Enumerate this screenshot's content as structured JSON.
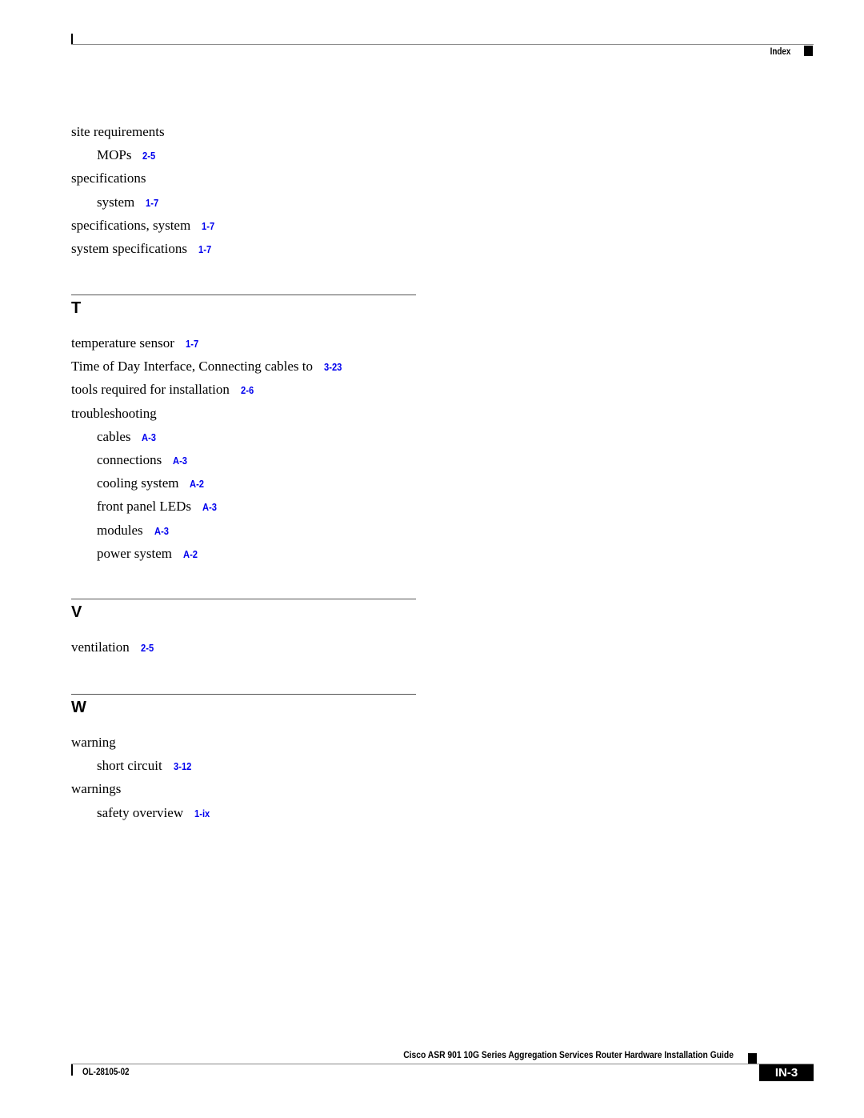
{
  "header": {
    "section_title": "Index"
  },
  "entries_s": [
    {
      "text": "site requirements",
      "ref": "",
      "level": 0
    },
    {
      "text": "MOPs",
      "ref": "2-5",
      "level": 1
    },
    {
      "text": "specifications",
      "ref": "",
      "level": 0
    },
    {
      "text": "system",
      "ref": "1-7",
      "level": 1
    },
    {
      "text": "specifications, system",
      "ref": "1-7",
      "level": 0
    },
    {
      "text": "system specifications",
      "ref": "1-7",
      "level": 0
    }
  ],
  "sections": [
    {
      "letter": "T",
      "entries": [
        {
          "text": "temperature sensor",
          "ref": "1-7",
          "level": 0
        },
        {
          "text": "Time of Day Interface, Connecting cables to",
          "ref": "3-23",
          "level": 0
        },
        {
          "text": "tools required for installation",
          "ref": "2-6",
          "level": 0
        },
        {
          "text": "troubleshooting",
          "ref": "",
          "level": 0
        },
        {
          "text": "cables",
          "ref": "A-3",
          "level": 1
        },
        {
          "text": "connections",
          "ref": "A-3",
          "level": 1
        },
        {
          "text": "cooling system",
          "ref": "A-2",
          "level": 1
        },
        {
          "text": "front panel LEDs",
          "ref": "A-3",
          "level": 1
        },
        {
          "text": "modules",
          "ref": "A-3",
          "level": 1
        },
        {
          "text": "power system",
          "ref": "A-2",
          "level": 1
        }
      ]
    },
    {
      "letter": "V",
      "entries": [
        {
          "text": "ventilation",
          "ref": "2-5",
          "level": 0
        }
      ]
    },
    {
      "letter": "W",
      "entries": [
        {
          "text": "warning",
          "ref": "",
          "level": 0
        },
        {
          "text": "short circuit",
          "ref": "3-12",
          "level": 1
        },
        {
          "text": "warnings",
          "ref": "",
          "level": 0
        },
        {
          "text": "safety overview",
          "ref": "1-ix",
          "level": 1
        }
      ]
    }
  ],
  "footer": {
    "book_title": "Cisco ASR 901 10G Series Aggregation Services Router Hardware Installation Guide",
    "doc_number": "OL-28105-02",
    "page_number": "IN-3"
  },
  "colors": {
    "link": "#0000ee"
  }
}
